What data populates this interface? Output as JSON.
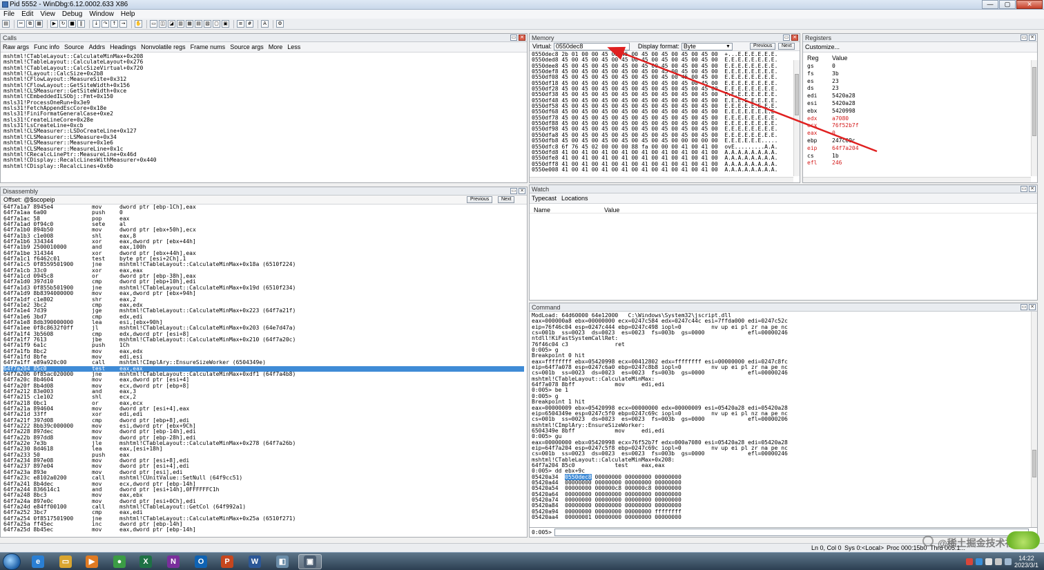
{
  "window": {
    "title": "Pid 5552 - WinDbg:6.12.0002.633 X86",
    "buttons": [
      "—",
      "▢",
      "✕"
    ]
  },
  "menu": [
    "File",
    "Edit",
    "View",
    "Debug",
    "Window",
    "Help"
  ],
  "calls": {
    "title": "Calls",
    "options": [
      "Raw args",
      "Func info",
      "Source",
      "Addrs",
      "Headings",
      "Nonvolatile regs",
      "Frame nums",
      "Source args",
      "More",
      "Less"
    ],
    "lines": [
      "mshtml!CTableLayout::CalculateMinMax+0x208",
      "mshtml!CTableLayout::CalculateLayout+0x276",
      "mshtml!CTableLayout::CalcSizeVirtual+0x720",
      "mshtml!CLayout::CalcSize+0x2b8",
      "mshtml!CFlowLayout::MeasureSite+0x312",
      "mshtml!CFlowLayout::GetSiteWidth+0x156",
      "mshtml!CLSMeasurer::GetSiteWidth+0xce",
      "mshtml!CEmbeddedILSObj::Fmt+0x150",
      "msls31!ProcessOneRun+0x3e9",
      "msls31!FetchAppendEscCore+0x18e",
      "msls31!FiniFormatGeneralCase+0xe2",
      "msls31!CreateLineCore+0x28e",
      "msls31!LsCreateLine+0xcb",
      "mshtml!CLSMeasurer::LSDoCreateLine+0x127",
      "mshtml!CLSMeasurer::LSMeasure+0x34",
      "mshtml!CLSMeasurer::Measure+0x1e6",
      "mshtml!CLSMeasurer::MeasureLine+0x1c",
      "mshtml!CRecalcLinePtr::MeasureLine+0x46d",
      "mshtml!CDisplay::RecalcLinesWithMeasurer+0x440",
      "mshtml!CDisplay::RecalcLines+0x6b"
    ]
  },
  "disassembly": {
    "title": "Disassembly",
    "offset_label": "Offset:",
    "offset_value": "@$scopeip",
    "previous": "Previous",
    "next": "Next",
    "rows": [
      [
        "64f7a1a7 8945e4",
        "mov",
        "dword ptr [ebp-1Ch],eax"
      ],
      [
        "64f7a1aa 6a00",
        "push",
        "0"
      ],
      [
        "64f7a1ac 58",
        "pop",
        "eax"
      ],
      [
        "64f7a1ad 0f94c0",
        "sete",
        "al"
      ],
      [
        "64f7a1b0 894b50",
        "mov",
        "dword ptr [ebx+50h],ecx"
      ],
      [
        "64f7a1b3 c1e008",
        "shl",
        "eax,8"
      ],
      [
        "64f7a1b6 334344",
        "xor",
        "eax,dword ptr [ebx+44h]"
      ],
      [
        "64f7a1b9 2500010000",
        "and",
        "eax,100h"
      ],
      [
        "64f7a1be 314344",
        "xor",
        "dword ptr [ebx+44h],eax"
      ],
      [
        "64f7a1c1 f6462c01",
        "test",
        "byte ptr [esi+2Ch],1"
      ],
      [
        "64f7a1c5 0f8559501900",
        "jne",
        "mshtml!CTableLayout::CalculateMinMax+0x18a (6510f224)"
      ],
      [
        "64f7a1cb 33c0",
        "xor",
        "eax,eax"
      ],
      [
        "64f7a1cd 0945c8",
        "or",
        "dword ptr [ebp-38h],eax"
      ],
      [
        "64f7a1d0 397d10",
        "cmp",
        "dword ptr [ebp+10h],edi"
      ],
      [
        "64f7a1d3 0f855b501900",
        "jne",
        "mshtml!CTableLayout::CalculateMinMax+0x19d (6510f234)"
      ],
      [
        "64f7a1d9 8b8394000000",
        "mov",
        "eax,dword ptr [ebx+94h]"
      ],
      [
        "64f7a1df c1e802",
        "shr",
        "eax,2"
      ],
      [
        "64f7a1e2 3bc2",
        "cmp",
        "eax,edx"
      ],
      [
        "64f7a1e4 7d39",
        "jge",
        "mshtml!CTableLayout::CalculateMinMax+0x223 (64f7a21f)"
      ],
      [
        "64f7a1e6 3bd7",
        "cmp",
        "edx,edi"
      ],
      [
        "64f7a1e8 8db390000000",
        "lea",
        "esi,[ebx+90h]"
      ],
      [
        "64f7a1ee 0f8c8632f0ff",
        "jl",
        "mshtml!CTableLayout::CalculateMinMax+0x203 (64e7d47a)"
      ],
      [
        "64f7a1f4 3b5608",
        "cmp",
        "edx,dword ptr [esi+8]"
      ],
      [
        "64f7a1f7 7613",
        "jbe",
        "mshtml!CTableLayout::CalculateMinMax+0x210 (64f7a20c)"
      ],
      [
        "64f7a1f9 6a1c",
        "push",
        "1Ch"
      ],
      [
        "64f7a1fb 8bc2",
        "mov",
        "eax,edx"
      ],
      [
        "64f7a1fd 8bfe",
        "mov",
        "edi,esi"
      ],
      [
        "64f7a1ff e89a920c00",
        "call",
        "mshtml!CImplAry::EnsureSizeWorker (6504349e)"
      ],
      [
        "64f7a204 85c0",
        "test",
        "eax,eax"
      ],
      [
        "64f7a206 0f85ac020000",
        "jne",
        "mshtml!CTableLayout::CalculateMinMax+0xdf1 (64f7a4b8)"
      ],
      [
        "64f7a20c 8b4604",
        "mov",
        "eax,dword ptr [esi+4]"
      ],
      [
        "64f7a20f 8b4d08",
        "mov",
        "ecx,dword ptr [ebp+8]"
      ],
      [
        "64f7a212 83e003",
        "and",
        "eax,3"
      ],
      [
        "64f7a215 c1e102",
        "shl",
        "ecx,2"
      ],
      [
        "64f7a218 0bc1",
        "or",
        "eax,ecx"
      ],
      [
        "64f7a21a 894604",
        "mov",
        "dword ptr [esi+4],eax"
      ],
      [
        "64f7a21d 33ff",
        "xor",
        "edi,edi"
      ],
      [
        "64f7a21f 397d08",
        "cmp",
        "dword ptr [ebp+8],edi"
      ],
      [
        "64f7a222 8bb39c000000",
        "mov",
        "esi,dword ptr [ebx+9Ch]"
      ],
      [
        "64f7a228 897dec",
        "mov",
        "dword ptr [ebp-14h],edi"
      ],
      [
        "64f7a22b 897dd8",
        "mov",
        "dword ptr [ebp-28h],edi"
      ],
      [
        "64f7a22e 7e3b",
        "jle",
        "mshtml!CTableLayout::CalculateMinMax+0x278 (64f7a26b)"
      ],
      [
        "64f7a230 8d4618",
        "lea",
        "eax,[esi+18h]"
      ],
      [
        "64f7a233 50",
        "push",
        "eax"
      ],
      [
        "64f7a234 897e08",
        "mov",
        "dword ptr [esi+8],edi"
      ],
      [
        "64f7a237 897e04",
        "mov",
        "dword ptr [esi+4],edi"
      ],
      [
        "64f7a23a 893e",
        "mov",
        "dword ptr [esi],edi"
      ],
      [
        "64f7a23c e8102a0200",
        "call",
        "mshtml!CUnitValue::SetNull (64f9cc51)"
      ],
      [
        "64f7a241 8b4dec",
        "mov",
        "ecx,dword ptr [ebp-14h]"
      ],
      [
        "64f7a244 836614c1",
        "and",
        "dword ptr [esi+14h],0FFFFFFC1h"
      ],
      [
        "64f7a248 8bc3",
        "mov",
        "eax,ebx"
      ],
      [
        "64f7a24a 897e0c",
        "mov",
        "dword ptr [esi+0Ch],edi"
      ],
      [
        "64f7a24d e84ff00100",
        "call",
        "mshtml!CTableLayout::GetCol (64f992a1)"
      ],
      [
        "64f7a252 3bc7",
        "cmp",
        "eax,edi"
      ],
      [
        "64f7a254 0f8517501900",
        "jne",
        "mshtml!CTableLayout::CalculateMinMax+0x25a (6510f271)"
      ],
      [
        "64f7a25a ff45ec",
        "inc",
        "dword ptr [ebp-14h]"
      ],
      [
        "64f7a25d 8b45ec",
        "mov",
        "eax,dword ptr [ebp-14h]"
      ]
    ]
  },
  "memory": {
    "title": "Memory",
    "virtual_label": "Virtual:",
    "virtual_value": "0550dec8",
    "format_label": "Display format:",
    "format_value": "Byte",
    "previous": "Previous",
    "next": "Next",
    "lines": [
      "0550dec8 2b 01 00 00 45 00 45 00 45 00 45 00 45 00 45 00  +...E.E.E.E.E.E.",
      "0550ded8 45 00 45 00 45 00 45 00 45 00 45 00 45 00 45 00  E.E.E.E.E.E.E.E.",
      "0550dee8 45 00 45 00 45 00 45 00 45 00 45 00 45 00 45 00  E.E.E.E.E.E.E.E.",
      "0550def8 45 00 45 00 45 00 45 00 45 00 45 00 45 00 45 00  E.E.E.E.E.E.E.E.",
      "0550df08 45 00 45 00 45 00 45 00 45 00 45 00 45 00 45 00  E.E.E.E.E.E.E.E.",
      "0550df18 45 00 45 00 45 00 45 00 45 00 45 00 45 00 45 00  E.E.E.E.E.E.E.E.",
      "0550df28 45 00 45 00 45 00 45 00 45 00 45 00 45 00 45 00  E.E.E.E.E.E.E.E.",
      "0550df38 45 00 45 00 45 00 45 00 45 00 45 00 45 00 45 00  E.E.E.E.E.E.E.E.",
      "0550df48 45 00 45 00 45 00 45 00 45 00 45 00 45 00 45 00  E.E.E.E.E.E.E.E.",
      "0550df58 45 00 45 00 45 00 45 00 45 00 45 00 45 00 45 00  E.E.E.E.E.E.E.E.",
      "0550df68 45 00 45 00 45 00 45 00 45 00 45 00 45 00 45 00  E.E.E.E.E.E.E.E.",
      "0550df78 45 00 45 00 45 00 45 00 45 00 45 00 45 00 45 00  E.E.E.E.E.E.E.E.",
      "0550df88 45 00 45 00 45 00 45 00 45 00 45 00 45 00 45 00  E.E.E.E.E.E.E.E.",
      "0550df98 45 00 45 00 45 00 45 00 45 00 45 00 45 00 45 00  E.E.E.E.E.E.E.E.",
      "0550dfa8 45 00 45 00 45 00 45 00 45 00 45 00 45 00 45 00  E.E.E.E.E.E.E.E.",
      "0550dfb8 45 00 45 00 45 00 45 00 45 00 45 00 00 00 00 00  E.E.E.E.E.E.....",
      "0550dfc8 6f 76 45 02 00 00 00 88 fa 00 00 00 41 00 41 00  ovE.........A.A.",
      "0550dfd8 41 00 41 00 41 00 41 00 41 00 41 00 41 00 41 00  A.A.A.A.A.A.A.A.",
      "0550dfe8 41 00 41 00 41 00 41 00 41 00 41 00 41 00 41 00  A.A.A.A.A.A.A.A.",
      "0550dff8 41 00 41 00 41 00 41 00 41 00 41 00 41 00 41 00  A.A.A.A.A.A.A.A.",
      "0550e008 41 00 41 00 41 00 41 00 41 00 41 00 41 00 41 00  A.A.A.A.A.A.A.A."
    ]
  },
  "registers": {
    "title": "Registers",
    "customize": "Customize...",
    "col_reg": "Reg",
    "col_value": "Value",
    "rows": [
      {
        "reg": "gs",
        "value": "0",
        "changed": false
      },
      {
        "reg": "fs",
        "value": "3b",
        "changed": false
      },
      {
        "reg": "es",
        "value": "23",
        "changed": false
      },
      {
        "reg": "ds",
        "value": "23",
        "changed": false
      },
      {
        "reg": "edi",
        "value": "5420a28",
        "changed": false
      },
      {
        "reg": "esi",
        "value": "5420a28",
        "changed": false
      },
      {
        "reg": "ebx",
        "value": "5420998",
        "changed": false
      },
      {
        "reg": "edx",
        "value": "a7080",
        "changed": true
      },
      {
        "reg": "ecx",
        "value": "76f52b7f",
        "changed": true
      },
      {
        "reg": "eax",
        "value": "0",
        "changed": true
      },
      {
        "reg": "ebp",
        "value": "247c69c",
        "changed": false
      },
      {
        "reg": "eip",
        "value": "64f7a204",
        "changed": true
      },
      {
        "reg": "cs",
        "value": "1b",
        "changed": false
      },
      {
        "reg": "efl",
        "value": "246",
        "changed": true
      }
    ],
    "changed_color": "#d41a1a"
  },
  "watch": {
    "title": "Watch",
    "options": [
      "Typecast",
      "Locations"
    ],
    "col_name": "Name",
    "col_value": "Value"
  },
  "command": {
    "title": "Command",
    "prompt": "0:005>",
    "lines": [
      "ModLoad: 64d60000 64e12000   C:\\Windows\\System32\\jscript.dll",
      "eax=000000a8 ebx=00000000 ecx=0247c584 edx=0247c44c esi=7ffda000 edi=0247c52c",
      "eip=76f46c04 esp=0247c444 ebp=0247c498 iopl=0         nv up ei pl zr na pe nc",
      "cs=001b  ss=0023  ds=0023  es=0023  fs=003b  gs=0000             efl=00000246",
      "ntdll!KiFastSystemCallRet:",
      "76f46c04 c3              ret",
      "0:005> g",
      "Breakpoint 0 hit",
      "eax=ffffffff ebx=05420998 ecx=00412802 edx=ffffffff esi=00000000 edi=0247c8fc",
      "eip=64f7a078 esp=0247c6a0 ebp=0247c8b8 iopl=0         nv up ei pl zr na pe nc",
      "cs=001b  ss=0023  ds=0023  es=0023  fs=003b  gs=0000             efl=00000246",
      "mshtml!CTableLayout::CalculateMinMax:",
      "64f7a078 8bff            mov     edi,edi",
      "0:005> be 1",
      "0:005> g",
      "Breakpoint 1 hit",
      "eax=00000009 ebx=05420998 ecx=00000000 edx=00000009 esi=05420a28 edi=05420a28",
      "eip=6504349e esp=0247c5f0 ebp=0247c69c iopl=0         nv up ei pl nz na pe nc",
      "cs=001b  ss=0023  ds=0023  es=0023  fs=003b  gs=0000             efl=00000206",
      "mshtml!CImplAry::EnsureSizeWorker:",
      "6504349e 8bff            mov     edi,edi",
      "0:005> gu",
      "eax=00000000 ebx=05420998 ecx=76f52b7f edx=000a7080 esi=05420a28 edi=05420a28",
      "eip=64f7a204 esp=0247c5f8 ebp=0247c69c iopl=0         nv up ei pl zr na pe nc",
      "cs=001b  ss=0023  ds=0023  es=0023  fs=003b  gs=0000             efl=00000246",
      "mshtml!CTableLayout::CalculateMinMax+0x208:",
      "64f7a204 85c0            test    eax,eax",
      "0:005> dd ebx+9c"
    ],
    "dump_rows": [
      [
        "05420a34",
        "0550dec8",
        "00000000 00000000 00000000"
      ],
      [
        "05420a44",
        "00000000",
        "00000000 00000000 00000000"
      ],
      [
        "05420a54",
        "00000000",
        "000000c8 000000c8 00000000"
      ],
      [
        "05420a64",
        "00000000",
        "00000000 00000000 00000000"
      ],
      [
        "05420a74",
        "00000000",
        "00000000 00000000 00000000"
      ],
      [
        "05420a84",
        "00000000",
        "00000000 00000000 00000000"
      ],
      [
        "05420a94",
        "00000000",
        "00000000 00000000 ffffffff"
      ],
      [
        "05420aa4",
        "00000001",
        "00000000 00000000 00000000"
      ]
    ]
  },
  "status": {
    "pos": "Ln 0, Col 0",
    "sys": "Sys 0:<Local>",
    "proc": "Proc 000:15b0",
    "thrd": "Thrd 005:1..."
  },
  "taskbar": {
    "apps": [
      {
        "name": "ie",
        "glyph": "e",
        "color": "#2a7fd4"
      },
      {
        "name": "explorer",
        "glyph": "▭",
        "color": "#d9a530"
      },
      {
        "name": "media",
        "glyph": "▶",
        "color": "#e07a22"
      },
      {
        "name": "chrome",
        "glyph": "●",
        "color": "#3b9c45"
      },
      {
        "name": "excel",
        "glyph": "X",
        "color": "#1e7145"
      },
      {
        "name": "onenote",
        "glyph": "N",
        "color": "#7a2e9c"
      },
      {
        "name": "outlook",
        "glyph": "O",
        "color": "#0f63b3"
      },
      {
        "name": "powerpoint",
        "glyph": "P",
        "color": "#c6461e"
      },
      {
        "name": "word",
        "glyph": "W",
        "color": "#2b5797"
      },
      {
        "name": "files",
        "glyph": "◧",
        "color": "#6a8ca8"
      },
      {
        "name": "windbg",
        "glyph": "▣",
        "color": "#4a5c70"
      }
    ],
    "time": "14:22",
    "date": "2023/3/1"
  },
  "watermark": "@稀土掘金技术社区"
}
